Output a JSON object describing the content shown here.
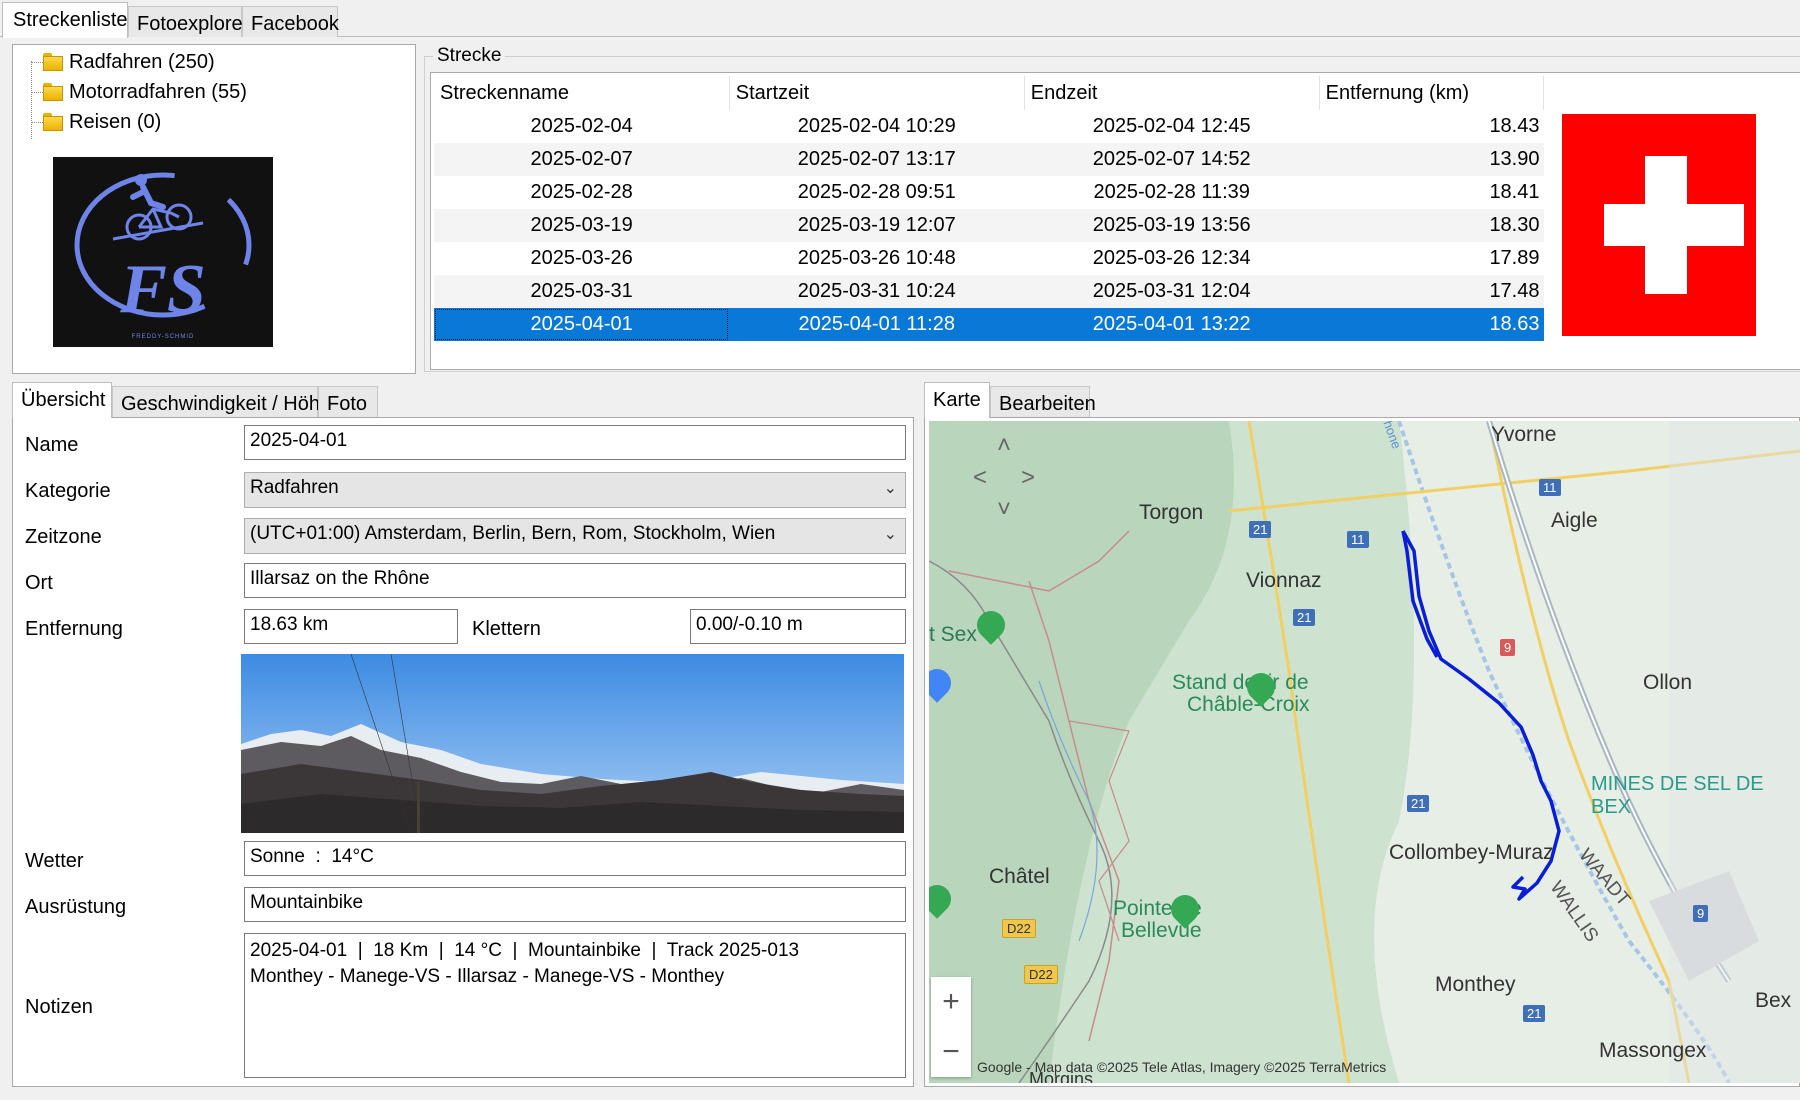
{
  "top_tabs": [
    "Streckenliste",
    "Fotoexplorer",
    "Facebook"
  ],
  "tree": [
    {
      "label": "Radfahren (250)"
    },
    {
      "label": "Motorradfahren (55)"
    },
    {
      "label": "Reisen (0)"
    }
  ],
  "logo": {
    "text": "FREDDY-SCHMID",
    "monogram": "FS",
    "color": "#6f84e8"
  },
  "track_group": {
    "title": "Strecke",
    "columns": [
      "Streckenname",
      "Startzeit",
      "Endzeit",
      "Entfernung (km)"
    ],
    "rows": [
      [
        "2025-02-04",
        "2025-02-04 10:29",
        "2025-02-04 12:45",
        "18.43"
      ],
      [
        "2025-02-07",
        "2025-02-07 13:17",
        "2025-02-07 14:52",
        "13.90"
      ],
      [
        "2025-02-28",
        "2025-02-28 09:51",
        "2025-02-28 11:39",
        "18.41"
      ],
      [
        "2025-03-19",
        "2025-03-19 12:07",
        "2025-03-19 13:56",
        "18.30"
      ],
      [
        "2025-03-26",
        "2025-03-26 10:48",
        "2025-03-26 12:34",
        "17.89"
      ],
      [
        "2025-03-31",
        "2025-03-31 10:24",
        "2025-03-31 12:04",
        "17.48"
      ],
      [
        "2025-04-01",
        "2025-04-01 11:28",
        "2025-04-01 13:22",
        "18.63"
      ]
    ],
    "selected_index": 6
  },
  "detail_tabs": [
    "Übersicht",
    "Geschwindigkeit / Höhe",
    "Foto"
  ],
  "form": {
    "name_label": "Name",
    "name_value": "2025-04-01",
    "category_label": "Kategorie",
    "category_value": "Radfahren",
    "timezone_label": "Zeitzone",
    "timezone_value": "(UTC+01:00) Amsterdam, Berlin, Bern, Rom, Stockholm, Wien",
    "place_label": "Ort",
    "place_value": "Illarsaz on the Rhône",
    "distance_label": "Entfernung",
    "distance_value": "18.63 km",
    "climb_label": "Klettern",
    "climb_value": "0.00/-0.10 m",
    "weather_label": "Wetter",
    "weather_value": "Sonne  :  14°C",
    "equipment_label": "Ausrüstung",
    "equipment_value": "Mountainbike",
    "notes_label": "Notizen",
    "notes_value": "2025-04-01  |  18 Km  |  14 °C  |  Mountainbike  |  Track 2025-013\nMonthey - Manege-VS - Illarsaz - Manege-VS - Monthey"
  },
  "map_tabs": [
    "Karte",
    "Bearbeiten"
  ],
  "map": {
    "places": [
      "Yvorne",
      "Torgon",
      "Aigle",
      "Vionnaz",
      "t Sex",
      "Stand de tir de",
      "Châble-Croix",
      "Ollon",
      "MINES DE SEL DE BEX",
      "Collombey-Muraz",
      "WAADT",
      "WALLIS",
      "Châtel",
      "Pointe de",
      "Bellevue",
      "Monthey",
      "Bex",
      "Massongex",
      "Morgins",
      "rhone"
    ],
    "road_badges": [
      "11",
      "21",
      "11",
      "21",
      "9",
      "21",
      "9",
      "21",
      "D22",
      "D22"
    ],
    "attribution": "Google - Map data ©2025 Tele Atlas, Imagery ©2025 TerraMetrics",
    "zoom_in": "+",
    "zoom_out": "−"
  },
  "colors": {
    "selection": "#0a78d7",
    "track": "#0a1ed8",
    "flag_red": "#ff0000"
  }
}
